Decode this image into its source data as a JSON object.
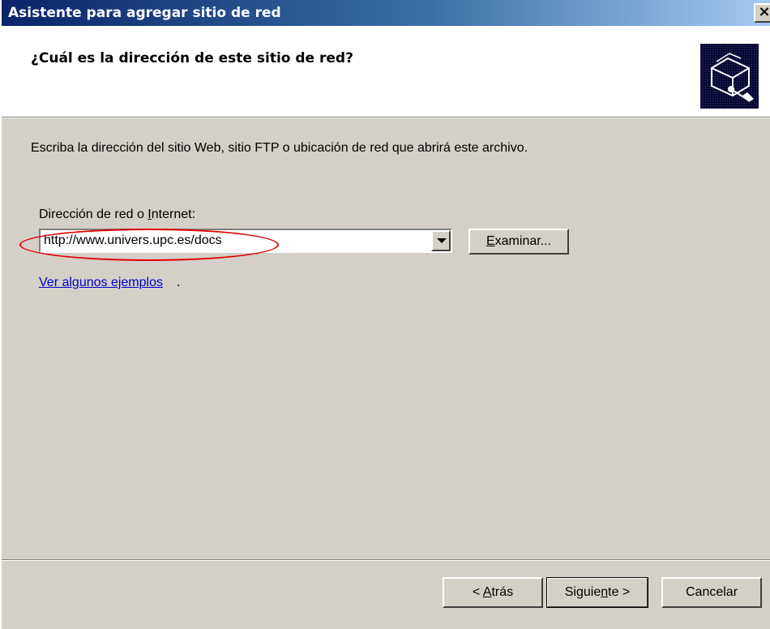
{
  "window": {
    "title": "Asistente para agregar sitio de red",
    "close_glyph": "×"
  },
  "header": {
    "question": "¿Cuál es la dirección de este sitio de red?",
    "icon": "network-folder-icon"
  },
  "content": {
    "instruction": "Escriba la dirección del sitio Web, sitio FTP o ubicación de red que abrirá este archivo.",
    "address_label_before": "Dirección de red o ",
    "address_label_accel": "I",
    "address_label_after": "nternet:",
    "address_value": "http://www.univers.upc.es/docs",
    "browse_accel": "E",
    "browse_rest": "xaminar...",
    "examples_link": "Ver algunos ejemplos",
    "examples_suffix": "."
  },
  "footer": {
    "back_prefix": "< ",
    "back_accel": "A",
    "back_rest": "trás",
    "next_before": "Siguie",
    "next_accel": "n",
    "next_after": "te >",
    "cancel_label": "Cancelar"
  },
  "colors": {
    "titlebar_start": "#0a246a",
    "titlebar_end": "#a6caf0",
    "dialog_face": "#d4d0c8",
    "link": "#0000cc",
    "annotation": "#e00000"
  }
}
